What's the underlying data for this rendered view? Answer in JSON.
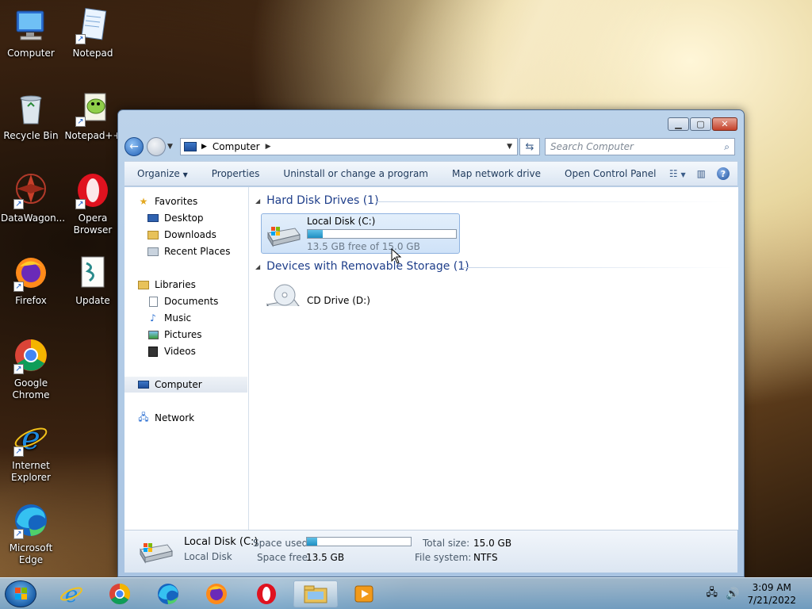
{
  "desktop": {
    "icons": [
      {
        "label": "Computer"
      },
      {
        "label": "Notepad"
      },
      {
        "label": "Recycle Bin"
      },
      {
        "label": "Notepad++"
      },
      {
        "label": "DataWagon..."
      },
      {
        "label": "Opera Browser"
      },
      {
        "label": "Firefox"
      },
      {
        "label": "Update"
      },
      {
        "label": "Google Chrome"
      },
      {
        "label": "Internet Explorer"
      },
      {
        "label": "Microsoft Edge"
      }
    ]
  },
  "window": {
    "address": {
      "segment": "Computer"
    },
    "search": {
      "placeholder": "Search Computer"
    },
    "toolbar": {
      "organize": "Organize",
      "properties": "Properties",
      "uninstall": "Uninstall or change a program",
      "map_drive": "Map network drive",
      "control_panel": "Open Control Panel"
    },
    "nav": {
      "favorites": "Favorites",
      "desktop": "Desktop",
      "downloads": "Downloads",
      "recent": "Recent Places",
      "libraries": "Libraries",
      "documents": "Documents",
      "music": "Music",
      "pictures": "Pictures",
      "videos": "Videos",
      "computer": "Computer",
      "network": "Network"
    },
    "content": {
      "hdd_group": "Hard Disk Drives (1)",
      "removable_group": "Devices with Removable Storage (1)",
      "local_disk": {
        "name": "Local Disk (C:)",
        "free_text": "13.5 GB free of 15.0 GB",
        "used_fraction": 0.1
      },
      "cd_drive": {
        "name": "CD Drive (D:)"
      }
    },
    "details": {
      "name": "Local Disk (C:)",
      "type": "Local Disk",
      "space_used_label": "Space used:",
      "space_free_label": "Space free:",
      "space_free_value": "13.5 GB",
      "total_size_label": "Total size:",
      "total_size_value": "15.0 GB",
      "file_system_label": "File system:",
      "file_system_value": "NTFS"
    }
  },
  "taskbar": {
    "time": "3:09 AM",
    "date": "7/21/2022"
  }
}
